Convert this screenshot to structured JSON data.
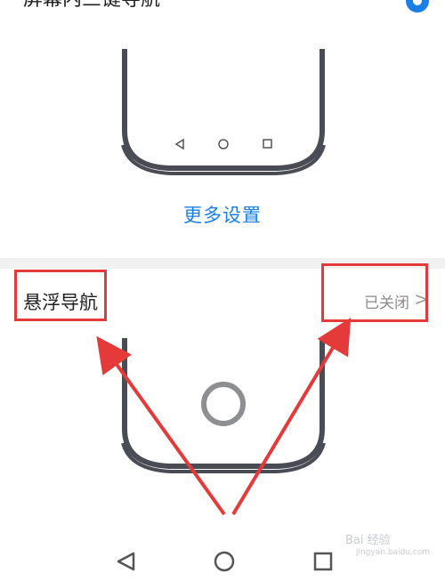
{
  "top_item": {
    "title": "屏幕内三键导航",
    "selected": true
  },
  "more_settings": {
    "label": "更多设置"
  },
  "floating_nav": {
    "label": "悬浮导航",
    "status": "已关闭",
    "chevron": ">"
  },
  "watermark": {
    "text": "Bai 经验",
    "url": "jingyan.baidu.com"
  },
  "icons": {
    "back": "back-triangle-icon",
    "home": "home-circle-icon",
    "recent": "recent-square-icon"
  },
  "colors": {
    "accent": "#1a7fe6",
    "annotation_red": "#e53a3a",
    "phone_frame": "#4a4c55"
  }
}
